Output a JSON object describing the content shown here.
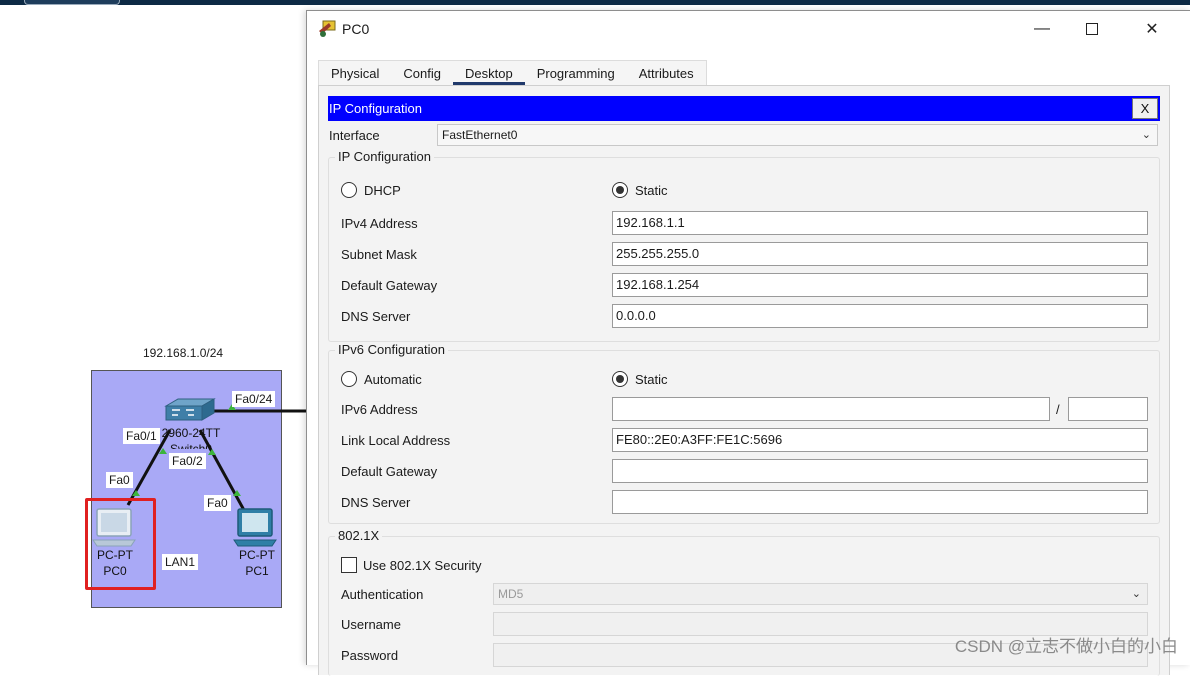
{
  "window": {
    "title": "PC0",
    "tabs": [
      "Physical",
      "Config",
      "Desktop",
      "Programming",
      "Attributes"
    ],
    "active_tab": "Desktop",
    "minimize_glyph": "—",
    "close_glyph": "✕"
  },
  "ip_config": {
    "header": "IP Configuration",
    "close_label": "X",
    "interface_label": "Interface",
    "interface_value": "FastEthernet0",
    "ipv4": {
      "group_title": "IP Configuration",
      "dhcp_label": "DHCP",
      "static_label": "Static",
      "mode": "Static",
      "ipv4_address_label": "IPv4 Address",
      "ipv4_address": "192.168.1.1",
      "subnet_mask_label": "Subnet Mask",
      "subnet_mask": "255.255.255.0",
      "default_gateway_label": "Default Gateway",
      "default_gateway": "192.168.1.254",
      "dns_server_label": "DNS Server",
      "dns_server": "0.0.0.0"
    },
    "ipv6": {
      "group_title": "IPv6 Configuration",
      "automatic_label": "Automatic",
      "static_label": "Static",
      "mode": "Static",
      "ipv6_address_label": "IPv6 Address",
      "ipv6_address": "",
      "prefix_separator": "/",
      "prefix_length": "",
      "link_local_label": "Link Local Address",
      "link_local_address": "FE80::2E0:A3FF:FE1C:5696",
      "default_gateway_label": "Default Gateway",
      "default_gateway": "",
      "dns_server_label": "DNS Server",
      "dns_server": ""
    },
    "dot1x": {
      "group_title": "802.1X",
      "use_security_label": "Use 802.1X Security",
      "use_security_checked": false,
      "authentication_label": "Authentication",
      "authentication_value": "MD5",
      "username_label": "Username",
      "username": "",
      "password_label": "Password",
      "password": ""
    }
  },
  "topology": {
    "network_label": "192.168.1.0/24",
    "lan_label": "LAN1",
    "switch_label_line1": "2960-24TT",
    "switch_label_line2": "Switch0",
    "ports": {
      "switch_uplink": "Fa0/24",
      "switch_to_pc0": "Fa0/1",
      "switch_to_pc1": "Fa0/2",
      "pc0_port": "Fa0",
      "pc1_port": "Fa0"
    },
    "pc0": {
      "type": "PC-PT",
      "name": "PC0"
    },
    "pc1": {
      "type": "PC-PT",
      "name": "PC1"
    },
    "link_color": "#111111",
    "port_led_color": "#3cb43c"
  },
  "watermark": "CSDN @立志不做小白的小白"
}
